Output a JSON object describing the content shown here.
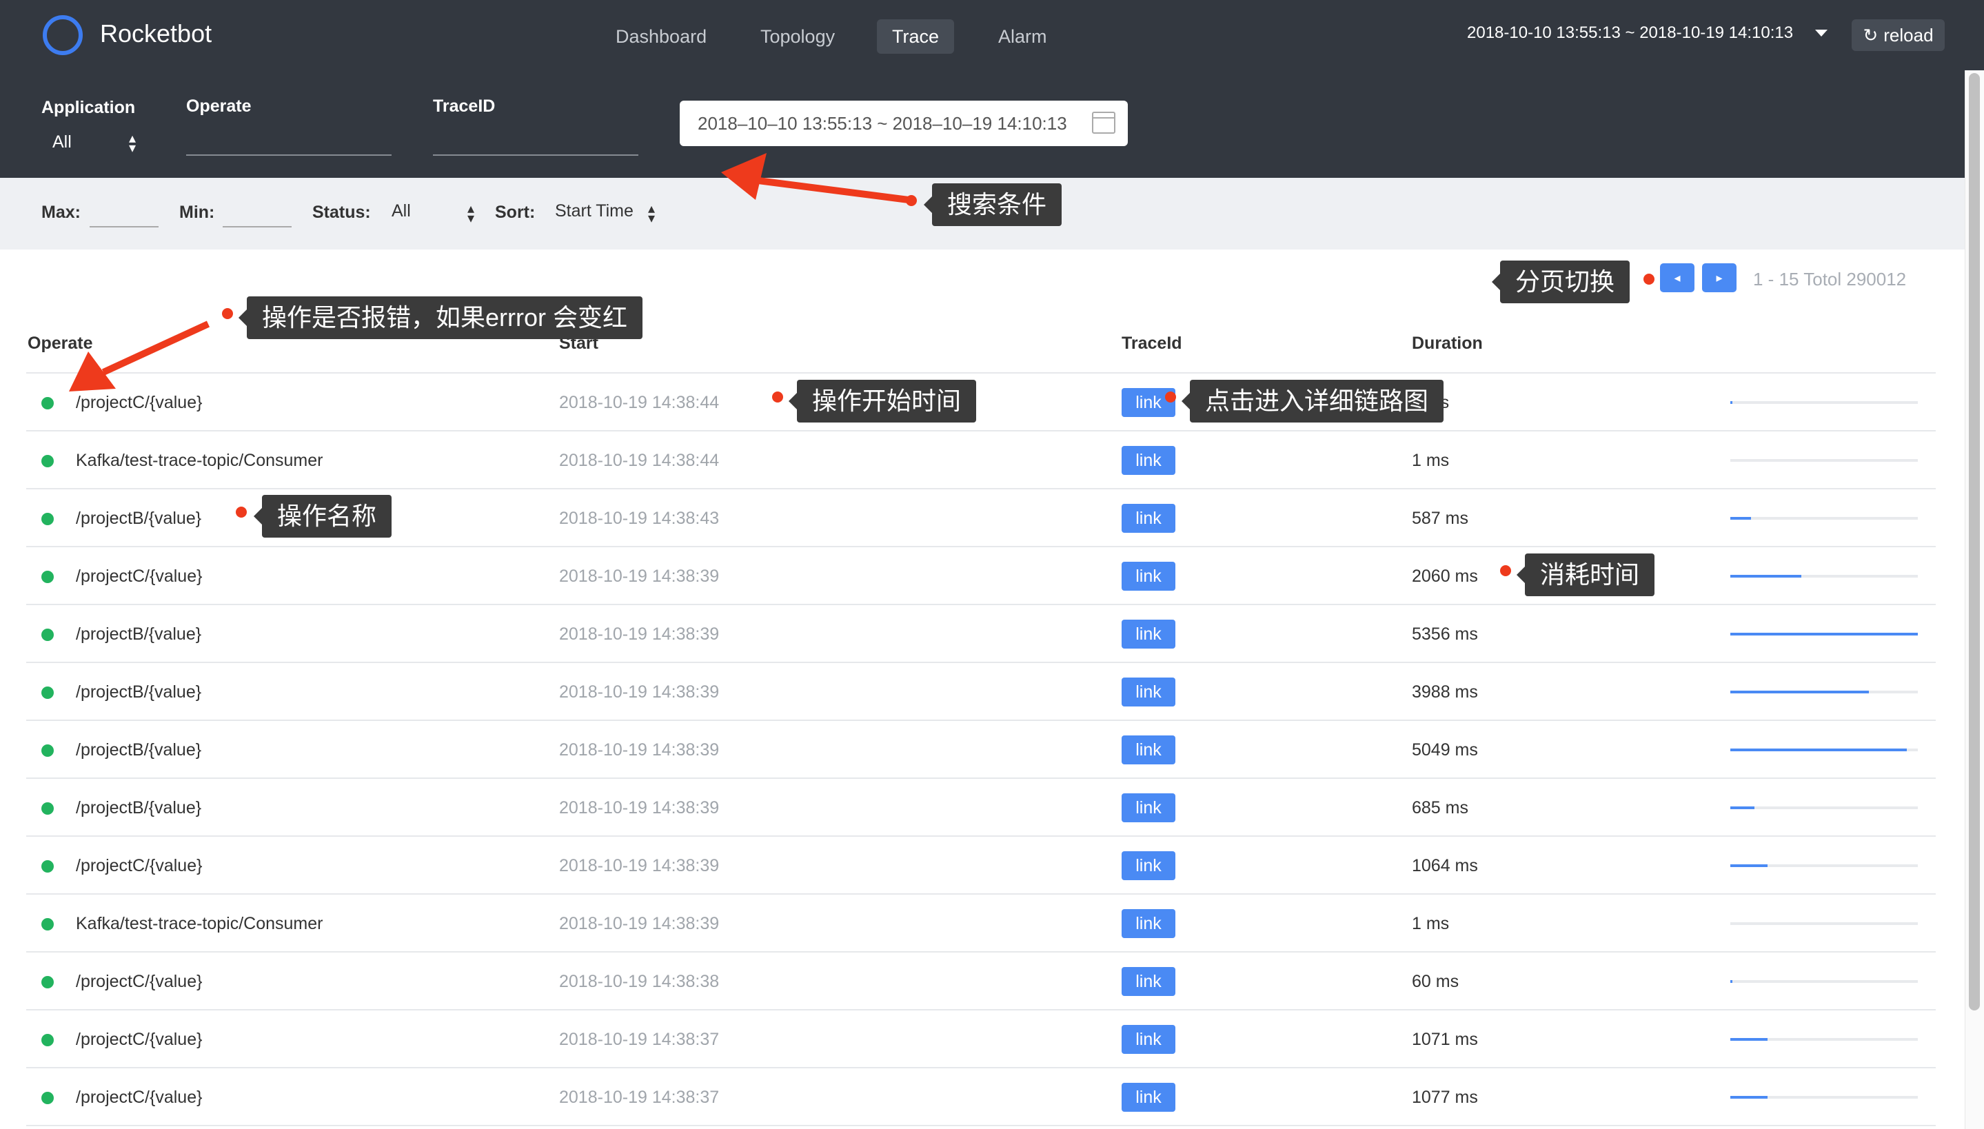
{
  "brand": {
    "name": "Rocketbot"
  },
  "nav": {
    "items": [
      "Dashboard",
      "Topology",
      "Trace",
      "Alarm"
    ],
    "active": "Trace",
    "time_range": "2018-10-10 13:55:13 ~ 2018-10-19 14:10:13",
    "reload_label": "reload"
  },
  "filters": {
    "application_label": "Application",
    "application_value": "All",
    "operate_label": "Operate",
    "traceid_label": "TraceID",
    "date_range": "2018–10–10 13:55:13 ~ 2018–10–19 14:10:13",
    "max_label": "Max:",
    "min_label": "Min:",
    "status_label": "Status:",
    "status_value": "All",
    "sort_label": "Sort:",
    "sort_value": "Start Time"
  },
  "pagination": {
    "info": "1 - 15 Totol 290012"
  },
  "table": {
    "headers": {
      "operate": "Operate",
      "start": "Start",
      "traceid": "TraceId",
      "duration": "Duration"
    },
    "rows": [
      {
        "operate": "/projectC/{value}",
        "start": "2018-10-19 14:38:44",
        "link": "link",
        "duration": "1 ms",
        "fraction": 0.01
      },
      {
        "operate": "Kafka/test-trace-topic/Consumer",
        "start": "2018-10-19 14:38:44",
        "link": "link",
        "duration": "1 ms",
        "fraction": 0.0
      },
      {
        "operate": "/projectB/{value}",
        "start": "2018-10-19 14:38:43",
        "link": "link",
        "duration": "587 ms",
        "fraction": 0.11
      },
      {
        "operate": "/projectC/{value}",
        "start": "2018-10-19 14:38:39",
        "link": "link",
        "duration": "2060 ms",
        "fraction": 0.38
      },
      {
        "operate": "/projectB/{value}",
        "start": "2018-10-19 14:38:39",
        "link": "link",
        "duration": "5356 ms",
        "fraction": 1.0
      },
      {
        "operate": "/projectB/{value}",
        "start": "2018-10-19 14:38:39",
        "link": "link",
        "duration": "3988 ms",
        "fraction": 0.74
      },
      {
        "operate": "/projectB/{value}",
        "start": "2018-10-19 14:38:39",
        "link": "link",
        "duration": "5049 ms",
        "fraction": 0.94
      },
      {
        "operate": "/projectB/{value}",
        "start": "2018-10-19 14:38:39",
        "link": "link",
        "duration": "685 ms",
        "fraction": 0.13
      },
      {
        "operate": "/projectC/{value}",
        "start": "2018-10-19 14:38:39",
        "link": "link",
        "duration": "1064 ms",
        "fraction": 0.2
      },
      {
        "operate": "Kafka/test-trace-topic/Consumer",
        "start": "2018-10-19 14:38:39",
        "link": "link",
        "duration": "1 ms",
        "fraction": 0.0
      },
      {
        "operate": "/projectC/{value}",
        "start": "2018-10-19 14:38:38",
        "link": "link",
        "duration": "60 ms",
        "fraction": 0.01
      },
      {
        "operate": "/projectC/{value}",
        "start": "2018-10-19 14:38:37",
        "link": "link",
        "duration": "1071 ms",
        "fraction": 0.2
      },
      {
        "operate": "/projectC/{value}",
        "start": "2018-10-19 14:38:37",
        "link": "link",
        "duration": "1077 ms",
        "fraction": 0.2
      }
    ]
  },
  "annotations": {
    "search": "搜索条件",
    "paging": "分页切换",
    "error": "操作是否报错，如果errror 会变红",
    "start_time": "操作开始时间",
    "detail": "点击进入详细链路图",
    "name": "操作名称",
    "duration": "消耗时间"
  },
  "colors": {
    "accent": "#4a8af4",
    "success": "#22b35e",
    "annotation_dot": "#ee3a1c",
    "header_bg": "#333840"
  }
}
